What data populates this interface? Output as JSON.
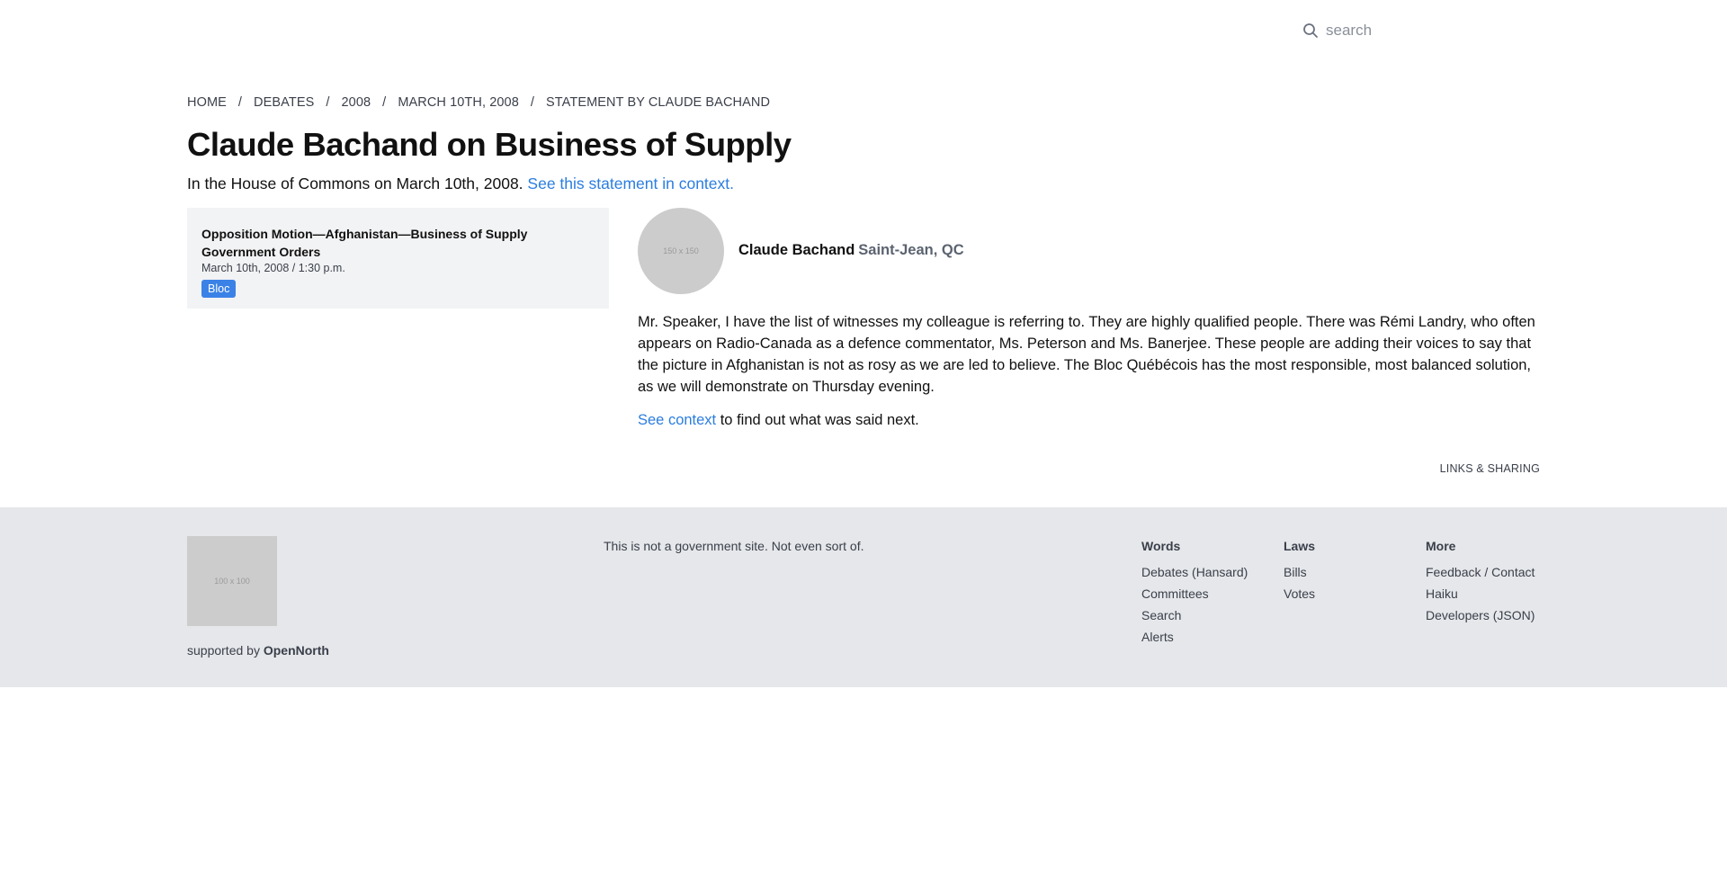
{
  "search": {
    "placeholder": "search"
  },
  "breadcrumb": [
    "HOME",
    "DEBATES",
    "2008",
    "MARCH 10TH, 2008",
    "STATEMENT BY CLAUDE BACHAND"
  ],
  "page": {
    "title": "Claude Bachand on Business of Supply",
    "intro_text": "In the House of Commons on March 10th, 2008.",
    "intro_link": "See this statement in context."
  },
  "sidebar": {
    "title_line1": "Opposition Motion—Afghanistan—Business of Supply",
    "title_line2": "Government Orders",
    "meta": "March 10th, 2008 / 1:30 p.m.",
    "badge": "Bloc"
  },
  "speaker": {
    "avatar_placeholder": "150 x 150",
    "name": "Claude Bachand",
    "riding": "Saint-Jean, QC"
  },
  "statement": "Mr. Speaker, I have the list of witnesses my colleague is referring to. They are highly qualified people. There was Rémi Landry, who often appears on Radio-Canada as a defence commentator, Ms. Peterson and Ms. Banerjee. These people are adding their voices to say that the picture in Afghanistan is not as rosy as we are led to believe. The Bloc Québécois has the most responsible, most balanced solution, as we will demonstrate on Thursday evening.",
  "context": {
    "link": "See context",
    "rest": " to find out what was said next."
  },
  "links_sharing": "LINKS & SHARING",
  "footer": {
    "logo_placeholder": "100 x 100",
    "supported_prefix": "supported by ",
    "supported_org": "OpenNorth",
    "disclaimer": "This is not a government site. Not even sort of.",
    "columns": [
      {
        "heading": "Words",
        "links": [
          "Debates (Hansard)",
          "Committees",
          "Search",
          "Alerts"
        ]
      },
      {
        "heading": "Laws",
        "links": [
          "Bills",
          "Votes"
        ]
      },
      {
        "heading": "More",
        "links": [
          "Feedback / Contact",
          "Haiku",
          "Developers (JSON)"
        ]
      }
    ]
  },
  "colors": {
    "link": "#2b7de0",
    "badge": "#3b82e6",
    "footer_bg": "#e5e7ea",
    "sidebar_bg": "#f2f3f4"
  }
}
